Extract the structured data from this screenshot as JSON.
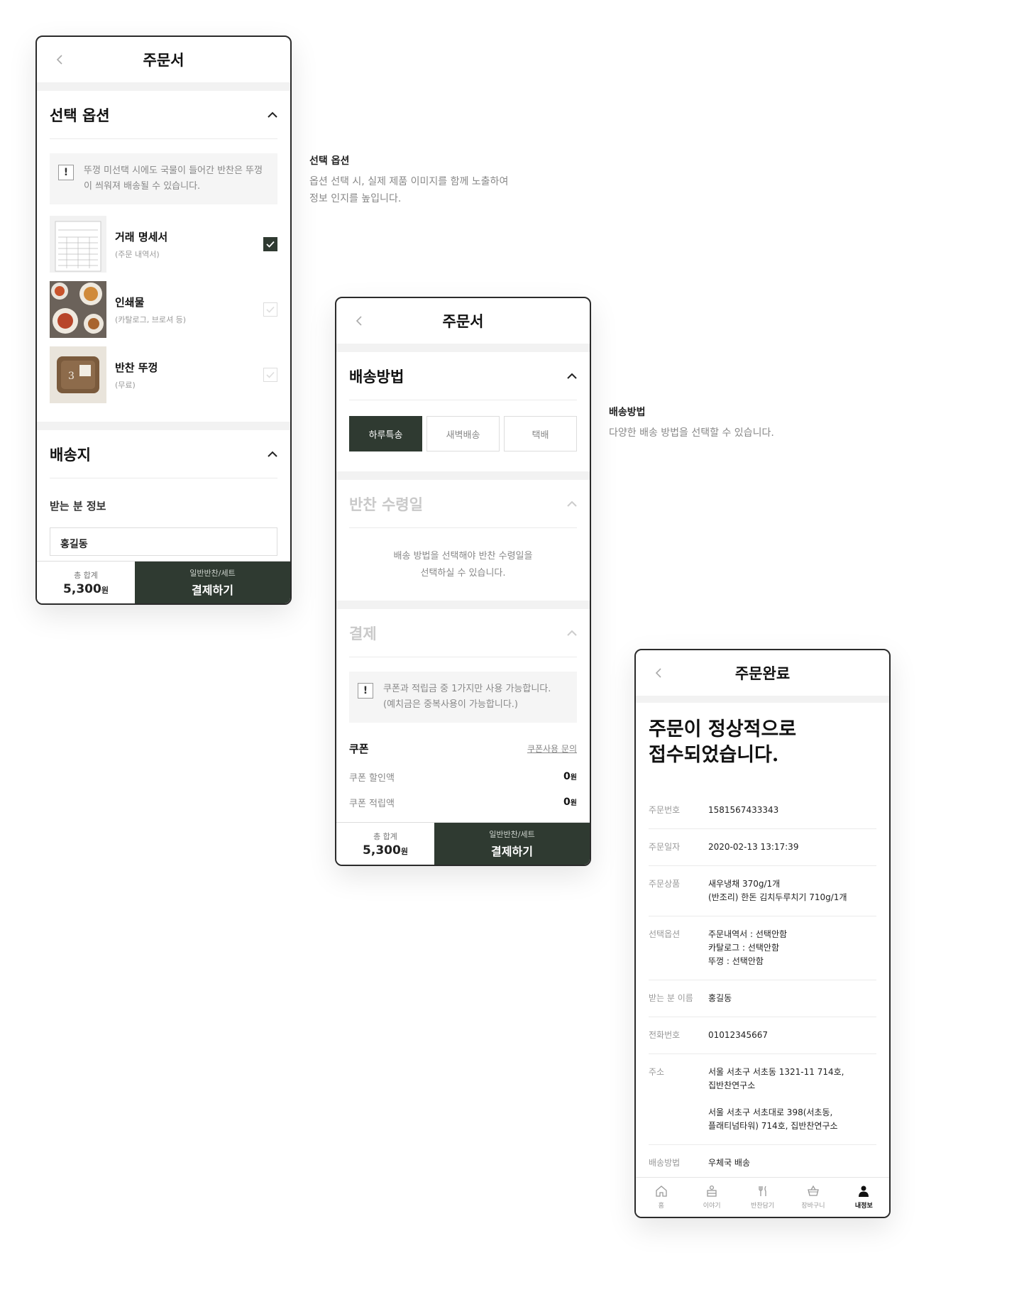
{
  "screen1": {
    "title": "주문서",
    "options_section": {
      "title": "선택 옵션",
      "notice": "뚜껑 미선택 시에도 국물이 들어간 반찬은 뚜껑이 씌워져 배송될 수 있습니다.",
      "items": [
        {
          "name": "거래 명세서",
          "sub": "(주문 내역서)",
          "checked": true
        },
        {
          "name": "인쇄물",
          "sub": "(카탈로그, 브로셔 등)",
          "checked": false
        },
        {
          "name": "반찬 뚜껑",
          "sub": "(무료)",
          "checked": false
        }
      ]
    },
    "shipping_section": {
      "title": "배송지",
      "recipient_label": "받는 분 정보",
      "recipient_value": "홍길동"
    },
    "bottom": {
      "total_label": "총 합계",
      "total_value": "5,300",
      "total_unit": "원",
      "pay_sub": "일반반찬/세트",
      "pay_label": "결제하기"
    }
  },
  "desc1": {
    "title": "선택 옵션",
    "body": "옵션 선택 시, 실제 제품 이미지를 함께 노출하여\n정보 인지를 높입니다."
  },
  "screen2": {
    "title": "주문서",
    "delivery_section": {
      "title": "배송방법",
      "options": [
        "하루특송",
        "새벽배송",
        "택배"
      ],
      "selected": 0
    },
    "date_section": {
      "title": "반찬 수령일",
      "message": "배송 방법을 선택해야 반찬 수령일을\n선택하실 수 있습니다."
    },
    "payment_section": {
      "title": "결제",
      "notice": "쿠폰과 적립금 중 1가지만 사용 가능합니다.\n(예치금은 중복사용이 가능합니다.)",
      "coupon_label": "쿠폰",
      "coupon_link": "쿠폰사용 문의",
      "rows": [
        {
          "label": "쿠폰 할인액",
          "value": "0",
          "unit": "원"
        },
        {
          "label": "쿠폰 적립액",
          "value": "0",
          "unit": "원"
        }
      ]
    },
    "bottom": {
      "total_label": "총 합계",
      "total_value": "5,300",
      "total_unit": "원",
      "pay_sub": "일반반찬/세트",
      "pay_label": "결제하기"
    }
  },
  "desc2": {
    "title": "배송방법",
    "body": "다양한 배송 방법을 선택할 수 있습니다."
  },
  "screen3": {
    "title": "주문완료",
    "headline": "주문이 정상적으로\n접수되었습니다.",
    "details": [
      {
        "k": "주문번호",
        "v": "1581567433343"
      },
      {
        "k": "주문일자",
        "v": "2020-02-13 13:17:39"
      },
      {
        "k": "주문상품",
        "v": "새우냉채 370g/1개\n(반조리) 한돈 김치두루치기 710g/1개"
      },
      {
        "k": "선택옵션",
        "v": "주문내역서 : 선택안함\n카탈로그 : 선택안함\n뚜껑 : 선택안함"
      },
      {
        "k": "받는 분 이름",
        "v": "홍길동"
      },
      {
        "k": "전화번호",
        "v": "01012345667"
      },
      {
        "k": "주소",
        "v": "서울 서초구 서초동 1321-11 714호,\n집반찬연구소\n\n서울 서초구 서초대로 398(서초동,\n플래티넘타워) 714호, 집반찬연구소"
      },
      {
        "k": "배송방법",
        "v": "우체국 배송"
      }
    ],
    "tabs": [
      {
        "label": "홈",
        "icon": "home-icon"
      },
      {
        "label": "이야기",
        "icon": "story-icon"
      },
      {
        "label": "반찬담기",
        "icon": "utensils-icon"
      },
      {
        "label": "장바구니",
        "icon": "basket-icon"
      },
      {
        "label": "내정보",
        "icon": "user-icon"
      }
    ],
    "active_tab": 4
  },
  "colors": {
    "brand": "#2f3a31",
    "background": "#ffffff",
    "muted": "#888888"
  }
}
